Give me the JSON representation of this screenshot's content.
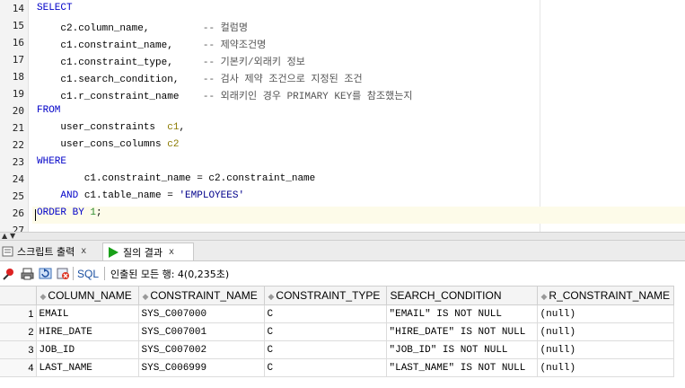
{
  "editor": {
    "line_numbers": [
      "14",
      "15",
      "16",
      "17",
      "18",
      "19",
      "20",
      "21",
      "22",
      "23",
      "24",
      "25",
      "26",
      "27"
    ],
    "lines": [
      [
        {
          "t": "SELECT",
          "c": "kw"
        }
      ],
      [
        {
          "t": "    c2.column_name,         ",
          "c": ""
        },
        {
          "t": "-- 컬럼명",
          "c": "cm"
        }
      ],
      [
        {
          "t": "    c1.constraint_name,     ",
          "c": ""
        },
        {
          "t": "-- 제약조건명",
          "c": "cm"
        }
      ],
      [
        {
          "t": "    c1.constraint_type,     ",
          "c": ""
        },
        {
          "t": "-- 기본키/외래키 정보",
          "c": "cm"
        }
      ],
      [
        {
          "t": "    c1.search_condition,    ",
          "c": ""
        },
        {
          "t": "-- 검사 제약 조건으로 지정된 조건",
          "c": "cm"
        }
      ],
      [
        {
          "t": "    c1.r_constraint_name    ",
          "c": ""
        },
        {
          "t": "-- 외래키인 경우 PRIMARY KEY를 참조했는지",
          "c": "cm"
        }
      ],
      [
        {
          "t": "FROM",
          "c": "kw"
        }
      ],
      [
        {
          "t": "    user_constraints  ",
          "c": ""
        },
        {
          "t": "c1",
          "c": "alias"
        },
        {
          "t": ",",
          "c": ""
        }
      ],
      [
        {
          "t": "    user_cons_columns ",
          "c": ""
        },
        {
          "t": "c2",
          "c": "alias"
        }
      ],
      [
        {
          "t": "WHERE",
          "c": "kw"
        }
      ],
      [
        {
          "t": "        c1.constraint_name = c2.constraint_name",
          "c": ""
        }
      ],
      [
        {
          "t": "    ",
          "c": ""
        },
        {
          "t": "AND",
          "c": "kw"
        },
        {
          "t": " c1.table_name = ",
          "c": ""
        },
        {
          "t": "'EMPLOYEES'",
          "c": "str"
        }
      ],
      [
        {
          "t": "ORDER BY",
          "c": "kw"
        },
        {
          "t": " ",
          "c": ""
        },
        {
          "t": "1",
          "c": "num"
        },
        {
          "t": ";",
          "c": ""
        }
      ],
      [
        {
          "t": "",
          "c": ""
        }
      ]
    ]
  },
  "tabs": [
    {
      "label": "스크립트 출력",
      "close": "x",
      "icon": "script-output-icon"
    },
    {
      "label": "질의 결과",
      "close": "x",
      "icon": "run-icon"
    }
  ],
  "toolbar": {
    "sql_label": "SQL",
    "status": "인출된 모든 행: 4(0,235초)"
  },
  "grid": {
    "columns": [
      "COLUMN_NAME",
      "CONSTRAINT_NAME",
      "CONSTRAINT_TYPE",
      "SEARCH_CONDITION",
      "R_CONSTRAINT_NAME"
    ],
    "rows": [
      {
        "num": "1",
        "cells": [
          "EMAIL",
          "SYS_C007000",
          "C",
          "\"EMAIL\" IS NOT NULL",
          "(null)"
        ]
      },
      {
        "num": "2",
        "cells": [
          "HIRE_DATE",
          "SYS_C007001",
          "C",
          "\"HIRE_DATE\" IS NOT NULL",
          "(null)"
        ]
      },
      {
        "num": "3",
        "cells": [
          "JOB_ID",
          "SYS_C007002",
          "C",
          "\"JOB_ID\" IS NOT NULL",
          "(null)"
        ]
      },
      {
        "num": "4",
        "cells": [
          "LAST_NAME",
          "SYS_C006999",
          "C",
          "\"LAST_NAME\" IS NOT NULL",
          "(null)"
        ]
      }
    ]
  },
  "colors": {
    "keyword": "#0000c8",
    "string": "#00008b",
    "number": "#2a8a2a",
    "comment": "#555555",
    "alias": "#8b7a00"
  }
}
